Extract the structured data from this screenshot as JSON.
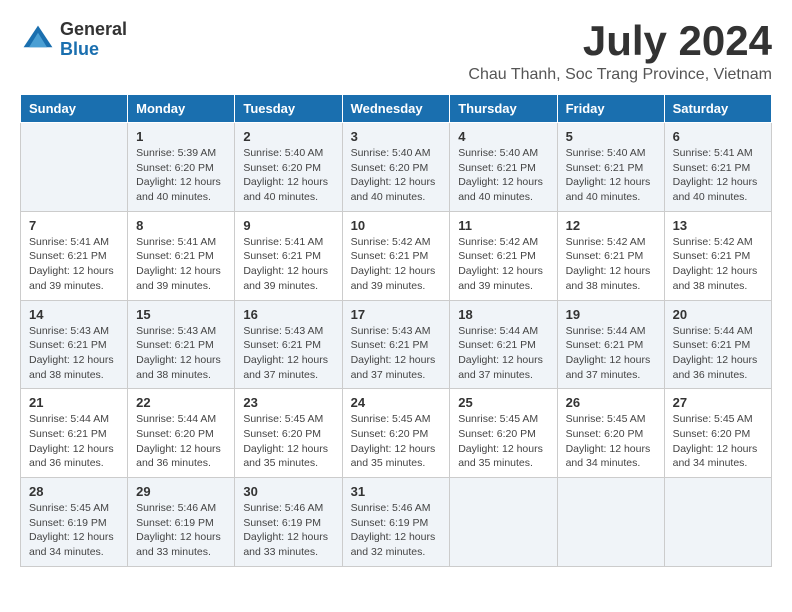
{
  "logo": {
    "general": "General",
    "blue": "Blue"
  },
  "title": {
    "month": "July 2024",
    "location": "Chau Thanh, Soc Trang Province, Vietnam"
  },
  "headers": [
    "Sunday",
    "Monday",
    "Tuesday",
    "Wednesday",
    "Thursday",
    "Friday",
    "Saturday"
  ],
  "weeks": [
    [
      {
        "day": "",
        "info": ""
      },
      {
        "day": "1",
        "info": "Sunrise: 5:39 AM\nSunset: 6:20 PM\nDaylight: 12 hours and 40 minutes."
      },
      {
        "day": "2",
        "info": "Sunrise: 5:40 AM\nSunset: 6:20 PM\nDaylight: 12 hours and 40 minutes."
      },
      {
        "day": "3",
        "info": "Sunrise: 5:40 AM\nSunset: 6:20 PM\nDaylight: 12 hours and 40 minutes."
      },
      {
        "day": "4",
        "info": "Sunrise: 5:40 AM\nSunset: 6:21 PM\nDaylight: 12 hours and 40 minutes."
      },
      {
        "day": "5",
        "info": "Sunrise: 5:40 AM\nSunset: 6:21 PM\nDaylight: 12 hours and 40 minutes."
      },
      {
        "day": "6",
        "info": "Sunrise: 5:41 AM\nSunset: 6:21 PM\nDaylight: 12 hours and 40 minutes."
      }
    ],
    [
      {
        "day": "7",
        "info": "Sunrise: 5:41 AM\nSunset: 6:21 PM\nDaylight: 12 hours and 39 minutes."
      },
      {
        "day": "8",
        "info": "Sunrise: 5:41 AM\nSunset: 6:21 PM\nDaylight: 12 hours and 39 minutes."
      },
      {
        "day": "9",
        "info": "Sunrise: 5:41 AM\nSunset: 6:21 PM\nDaylight: 12 hours and 39 minutes."
      },
      {
        "day": "10",
        "info": "Sunrise: 5:42 AM\nSunset: 6:21 PM\nDaylight: 12 hours and 39 minutes."
      },
      {
        "day": "11",
        "info": "Sunrise: 5:42 AM\nSunset: 6:21 PM\nDaylight: 12 hours and 39 minutes."
      },
      {
        "day": "12",
        "info": "Sunrise: 5:42 AM\nSunset: 6:21 PM\nDaylight: 12 hours and 38 minutes."
      },
      {
        "day": "13",
        "info": "Sunrise: 5:42 AM\nSunset: 6:21 PM\nDaylight: 12 hours and 38 minutes."
      }
    ],
    [
      {
        "day": "14",
        "info": "Sunrise: 5:43 AM\nSunset: 6:21 PM\nDaylight: 12 hours and 38 minutes."
      },
      {
        "day": "15",
        "info": "Sunrise: 5:43 AM\nSunset: 6:21 PM\nDaylight: 12 hours and 38 minutes."
      },
      {
        "day": "16",
        "info": "Sunrise: 5:43 AM\nSunset: 6:21 PM\nDaylight: 12 hours and 37 minutes."
      },
      {
        "day": "17",
        "info": "Sunrise: 5:43 AM\nSunset: 6:21 PM\nDaylight: 12 hours and 37 minutes."
      },
      {
        "day": "18",
        "info": "Sunrise: 5:44 AM\nSunset: 6:21 PM\nDaylight: 12 hours and 37 minutes."
      },
      {
        "day": "19",
        "info": "Sunrise: 5:44 AM\nSunset: 6:21 PM\nDaylight: 12 hours and 37 minutes."
      },
      {
        "day": "20",
        "info": "Sunrise: 5:44 AM\nSunset: 6:21 PM\nDaylight: 12 hours and 36 minutes."
      }
    ],
    [
      {
        "day": "21",
        "info": "Sunrise: 5:44 AM\nSunset: 6:21 PM\nDaylight: 12 hours and 36 minutes."
      },
      {
        "day": "22",
        "info": "Sunrise: 5:44 AM\nSunset: 6:20 PM\nDaylight: 12 hours and 36 minutes."
      },
      {
        "day": "23",
        "info": "Sunrise: 5:45 AM\nSunset: 6:20 PM\nDaylight: 12 hours and 35 minutes."
      },
      {
        "day": "24",
        "info": "Sunrise: 5:45 AM\nSunset: 6:20 PM\nDaylight: 12 hours and 35 minutes."
      },
      {
        "day": "25",
        "info": "Sunrise: 5:45 AM\nSunset: 6:20 PM\nDaylight: 12 hours and 35 minutes."
      },
      {
        "day": "26",
        "info": "Sunrise: 5:45 AM\nSunset: 6:20 PM\nDaylight: 12 hours and 34 minutes."
      },
      {
        "day": "27",
        "info": "Sunrise: 5:45 AM\nSunset: 6:20 PM\nDaylight: 12 hours and 34 minutes."
      }
    ],
    [
      {
        "day": "28",
        "info": "Sunrise: 5:45 AM\nSunset: 6:19 PM\nDaylight: 12 hours and 34 minutes."
      },
      {
        "day": "29",
        "info": "Sunrise: 5:46 AM\nSunset: 6:19 PM\nDaylight: 12 hours and 33 minutes."
      },
      {
        "day": "30",
        "info": "Sunrise: 5:46 AM\nSunset: 6:19 PM\nDaylight: 12 hours and 33 minutes."
      },
      {
        "day": "31",
        "info": "Sunrise: 5:46 AM\nSunset: 6:19 PM\nDaylight: 12 hours and 32 minutes."
      },
      {
        "day": "",
        "info": ""
      },
      {
        "day": "",
        "info": ""
      },
      {
        "day": "",
        "info": ""
      }
    ]
  ]
}
